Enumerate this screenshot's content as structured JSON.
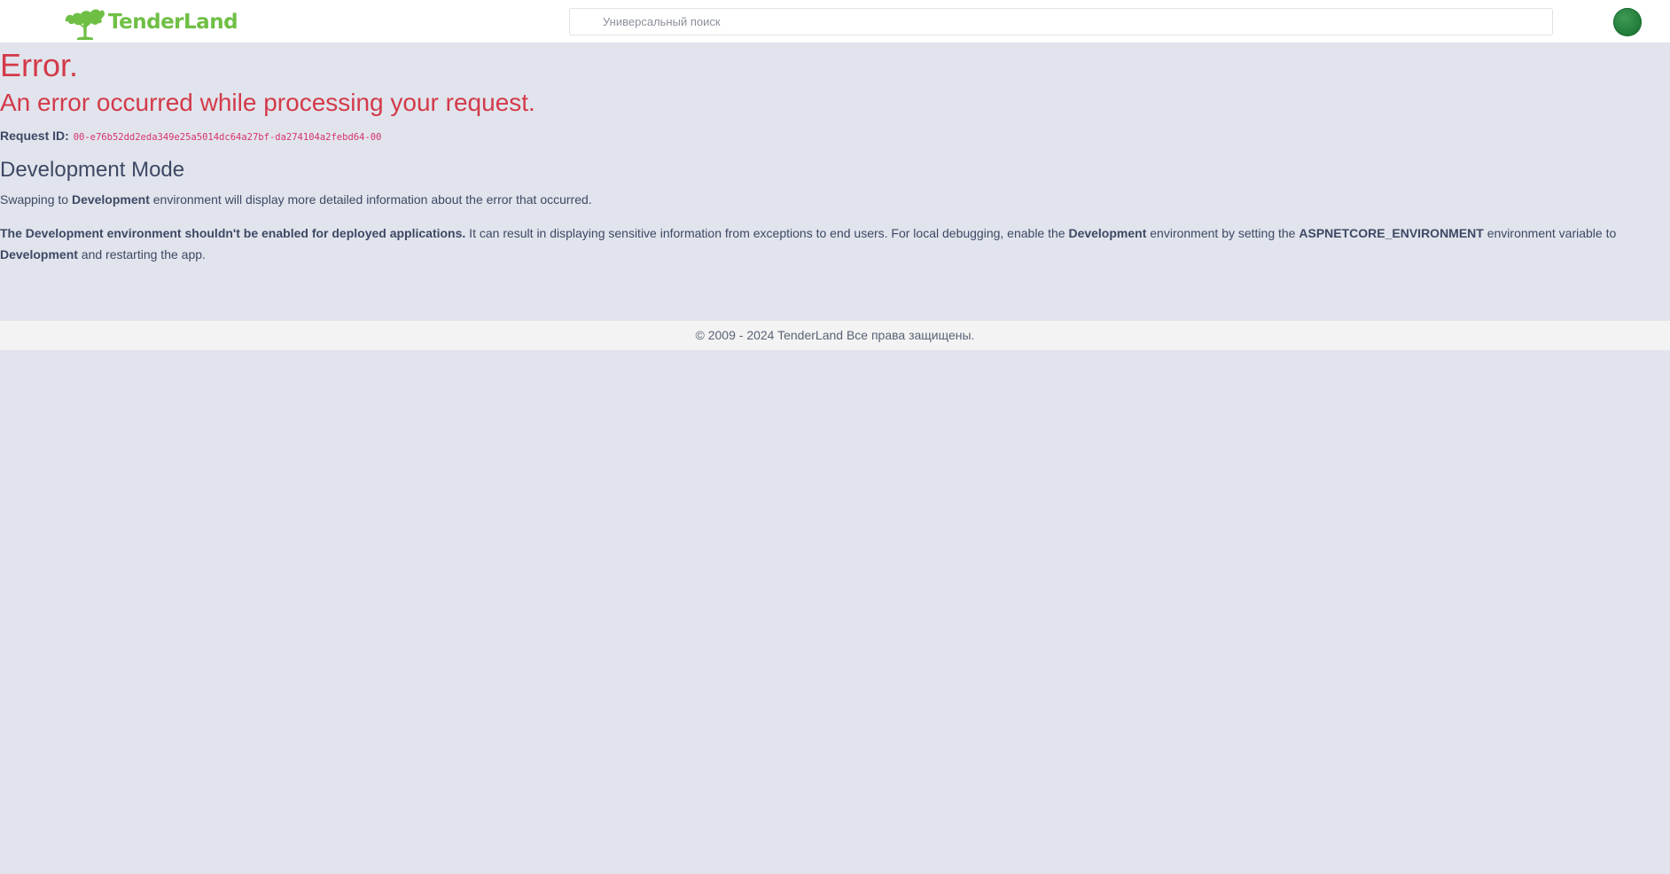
{
  "header": {
    "logo_text": "TenderLand",
    "search": {
      "placeholder": "Универсальный поиск",
      "value": ""
    },
    "avatar_color": "#1f7a38"
  },
  "error": {
    "title": "Error.",
    "subtitle": "An error occurred while processing your request.",
    "request_id_label": "Request ID:",
    "request_id_value": "00-e76b52dd2eda349e25a5014dc64a27bf-da274104a2febd64-00"
  },
  "dev_mode": {
    "heading": "Development Mode",
    "para1": {
      "t1": "Swapping to ",
      "b1": "Development",
      "t2": " environment will display more detailed information about the error that occurred."
    },
    "para2": {
      "b1": "The Development environment shouldn't be enabled for deployed applications.",
      "t1": " It can result in displaying sensitive information from exceptions to end users. For local debugging, enable the ",
      "b2": "Development",
      "t2": " environment by setting the ",
      "b3": "ASPNETCORE_ENVIRONMENT",
      "t3": " environment variable to ",
      "b4": "Development",
      "t4": " and restarting the app."
    }
  },
  "footer": {
    "text": "© 2009 - 2024 TenderLand Все права защищены."
  },
  "colors": {
    "error_red": "#d33a4a",
    "brand_green": "#6fbf45",
    "page_bg": "#e1e4ec",
    "code_pink": "#d6336c"
  }
}
